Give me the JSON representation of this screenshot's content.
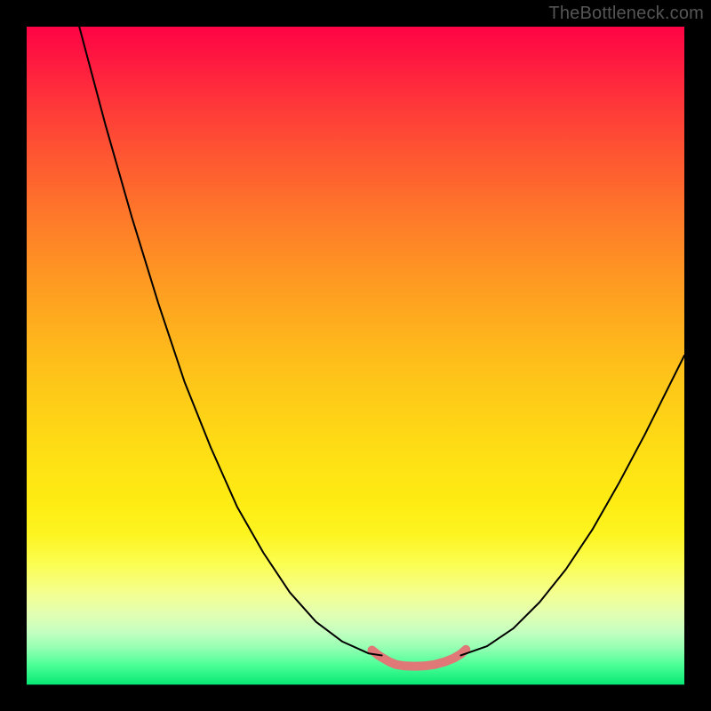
{
  "watermark": "TheBottleneck.com",
  "chart_data": {
    "type": "line",
    "title": "",
    "xlabel": "",
    "ylabel": "",
    "xlim": [
      0,
      100
    ],
    "ylim": [
      0,
      100
    ],
    "grid": false,
    "legend": false,
    "series": [
      {
        "name": "left-curve",
        "x": [
          8,
          12,
          16,
          20,
          24,
          28,
          32,
          36,
          40,
          44,
          48,
          52,
          54
        ],
        "y": [
          0,
          15,
          29,
          42,
          54,
          64,
          73,
          80,
          86,
          90.5,
          93.5,
          95.3,
          95.6
        ],
        "stroke": "#000000",
        "width": 2
      },
      {
        "name": "right-curve",
        "x": [
          66,
          70,
          74,
          78,
          82,
          86,
          90,
          94,
          98,
          100
        ],
        "y": [
          95.6,
          94.2,
          91.5,
          87.5,
          82.5,
          76.5,
          69.5,
          62,
          54,
          50
        ],
        "stroke": "#000000",
        "width": 2
      },
      {
        "name": "valley-pink",
        "x": [
          52.5,
          53.5,
          54.5,
          55.2,
          56.2,
          57.5,
          59,
          60.5,
          62,
          63.5,
          65,
          66,
          66.8
        ],
        "y": [
          94.8,
          95.6,
          96.2,
          96.6,
          97.0,
          97.2,
          97.25,
          97.2,
          97.0,
          96.6,
          96.0,
          95.4,
          94.7
        ],
        "stroke": "#e07878",
        "width": 10
      }
    ],
    "background_bands": [
      {
        "y0": 0,
        "y1": 6,
        "c0": "#fe0345",
        "c1": "#fe1d3f"
      },
      {
        "y0": 6,
        "y1": 12,
        "c0": "#fe1d3f",
        "c1": "#fe3839"
      },
      {
        "y0": 12,
        "y1": 18,
        "c0": "#fe3839",
        "c1": "#fe5033"
      },
      {
        "y0": 18,
        "y1": 24,
        "c0": "#fe5033",
        "c1": "#fe672e"
      },
      {
        "y0": 24,
        "y1": 30,
        "c0": "#fe672e",
        "c1": "#fe7d29"
      },
      {
        "y0": 30,
        "y1": 36,
        "c0": "#fe7d29",
        "c1": "#fe9124"
      },
      {
        "y0": 36,
        "y1": 42,
        "c0": "#fe9124",
        "c1": "#fea420"
      },
      {
        "y0": 42,
        "y1": 48,
        "c0": "#fea420",
        "c1": "#feb61c"
      },
      {
        "y0": 48,
        "y1": 54,
        "c0": "#feb61c",
        "c1": "#fec619"
      },
      {
        "y0": 54,
        "y1": 60,
        "c0": "#fec619",
        "c1": "#fed416"
      },
      {
        "y0": 60,
        "y1": 66,
        "c0": "#fed416",
        "c1": "#fee114"
      },
      {
        "y0": 66,
        "y1": 72,
        "c0": "#fee114",
        "c1": "#feeb13"
      },
      {
        "y0": 72,
        "y1": 77,
        "c0": "#feeb13",
        "c1": "#fdf41f"
      },
      {
        "y0": 77,
        "y1": 82,
        "c0": "#fdf41f",
        "c1": "#fbfe55"
      },
      {
        "y0": 82,
        "y1": 86,
        "c0": "#fbfe55",
        "c1": "#f4ff8e"
      },
      {
        "y0": 86,
        "y1": 89,
        "c0": "#f4ff8e",
        "c1": "#e4ffb0"
      },
      {
        "y0": 89,
        "y1": 92,
        "c0": "#e4ffb0",
        "c1": "#c4ffc0"
      },
      {
        "y0": 92,
        "y1": 94.5,
        "c0": "#c4ffc0",
        "c1": "#93ffb2"
      },
      {
        "y0": 94.5,
        "y1": 97,
        "c0": "#93ffb2",
        "c1": "#4dff97"
      },
      {
        "y0": 97,
        "y1": 100,
        "c0": "#4dff97",
        "c1": "#07e874"
      }
    ]
  }
}
